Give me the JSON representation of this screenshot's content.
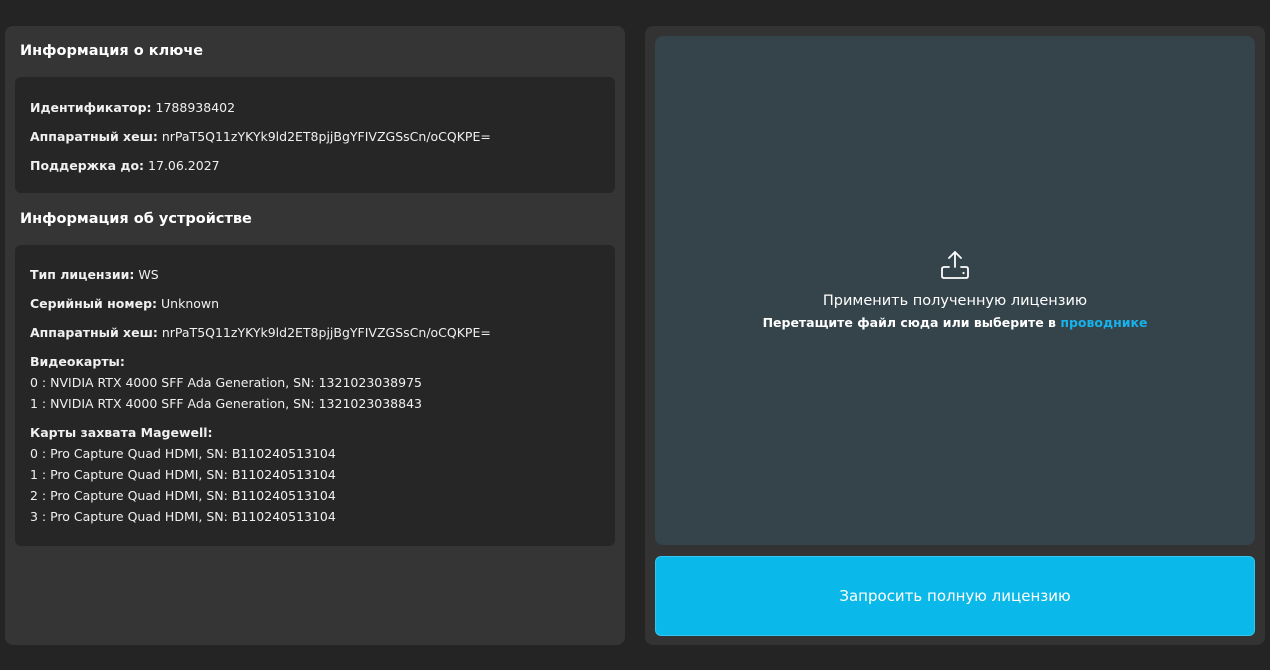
{
  "key_info": {
    "title": "Информация о ключе",
    "rows": [
      {
        "label": "Идентификатор:",
        "value": "1788938402"
      },
      {
        "label": "Аппаратный хеш:",
        "value": "nrPaT5Q11zYKYk9ld2ET8pjjBgYFIVZGSsCn/oCQKPE="
      },
      {
        "label": "Поддержка до:",
        "value": "17.06.2027"
      }
    ]
  },
  "device_info": {
    "title": "Информация об устройстве",
    "rows": [
      {
        "label": "Тип лицензии:",
        "value": "WS"
      },
      {
        "label": "Серийный номер:",
        "value": "Unknown"
      },
      {
        "label": "Аппаратный хеш:",
        "value": "nrPaT5Q11zYKYk9ld2ET8pjjBgYFIVZGSsCn/oCQKPE="
      }
    ],
    "gpus_label": "Видеокарты:",
    "gpus": [
      "0 : NVIDIA RTX 4000 SFF Ada Generation, SN: 1321023038975",
      "1 : NVIDIA RTX 4000 SFF Ada Generation, SN: 1321023038843"
    ],
    "capture_label": "Карты захвата Magewell:",
    "capture_cards": [
      "0 : Pro Capture Quad HDMI, SN: B110240513104",
      "1 : Pro Capture Quad HDMI, SN: B110240513104",
      "2 : Pro Capture Quad HDMI, SN: B110240513104",
      "3 : Pro Capture Quad HDMI, SN: B110240513104"
    ]
  },
  "drop_zone": {
    "icon": "upload-icon",
    "title": "Применить полученную лицензию",
    "hint": "Перетащите файл сюда или выберите в",
    "link": "проводнике"
  },
  "request_button": {
    "label": "Запросить полную лицензию"
  },
  "colors": {
    "accent": "#0ab8ea",
    "link": "#18b1ea",
    "drop_zone_bg": "#34444a",
    "panel_bg": "#353535",
    "card_bg": "#262626"
  }
}
